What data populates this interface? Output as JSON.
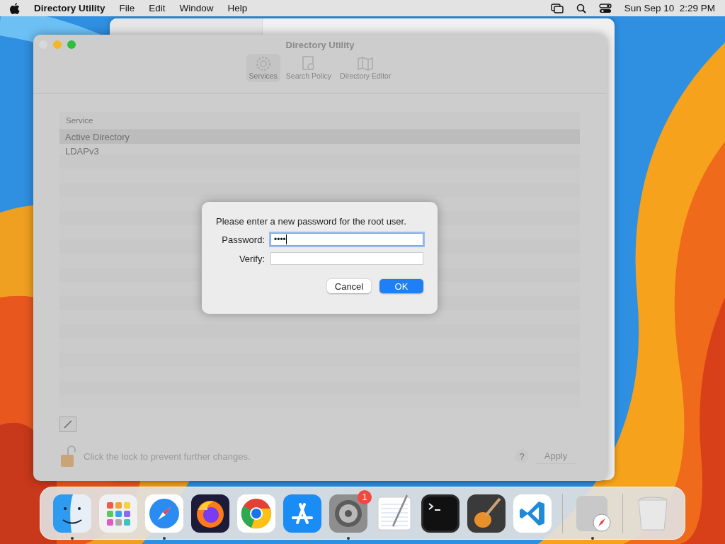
{
  "menu_bar": {
    "app_name": "Directory Utility",
    "menus": [
      "File",
      "Edit",
      "Window",
      "Help"
    ],
    "clock": "Sun Sep 10  2:29 PM"
  },
  "window": {
    "title": "Directory Utility",
    "toolbar": [
      {
        "kind": "gear",
        "label": "Services",
        "selected": true
      },
      {
        "kind": "search",
        "label": "Search Policy",
        "selected": false
      },
      {
        "kind": "map",
        "label": "Directory Editor",
        "selected": false
      }
    ],
    "table": {
      "column": "Service",
      "rows": [
        {
          "label": "Active Directory",
          "selected": true
        },
        {
          "label": "LDAPv3",
          "selected": false
        }
      ]
    },
    "lock_text": "Click the lock to prevent further changes.",
    "help": "?",
    "apply": {
      "label": "Apply",
      "disabled": true
    }
  },
  "dialog": {
    "message": "Please enter a new password for the root user.",
    "fields": [
      {
        "label": "Password:",
        "value": "••••",
        "focused": true
      },
      {
        "label": "Verify:",
        "focused": false
      }
    ],
    "buttons": [
      {
        "label": "Cancel",
        "kind": "secondary"
      },
      {
        "label": "OK",
        "kind": "primary"
      }
    ]
  },
  "dock": {
    "items": [
      {
        "kind": "finder",
        "running": true
      },
      {
        "kind": "launchpad",
        "running": false
      },
      {
        "kind": "safari",
        "running": true
      },
      {
        "kind": "firefox",
        "running": false
      },
      {
        "kind": "chrome",
        "running": false
      },
      {
        "kind": "appstore",
        "running": false
      },
      {
        "kind": "settings",
        "running": true,
        "badge": "1"
      },
      {
        "kind": "textedit",
        "running": false
      },
      {
        "kind": "terminal",
        "running": false
      },
      {
        "kind": "garageband",
        "running": false
      },
      {
        "kind": "vscode",
        "running": false
      },
      {
        "kind": "separator"
      },
      {
        "kind": "utility",
        "running": true
      },
      {
        "kind": "separator"
      },
      {
        "kind": "trash",
        "running": false
      }
    ]
  }
}
